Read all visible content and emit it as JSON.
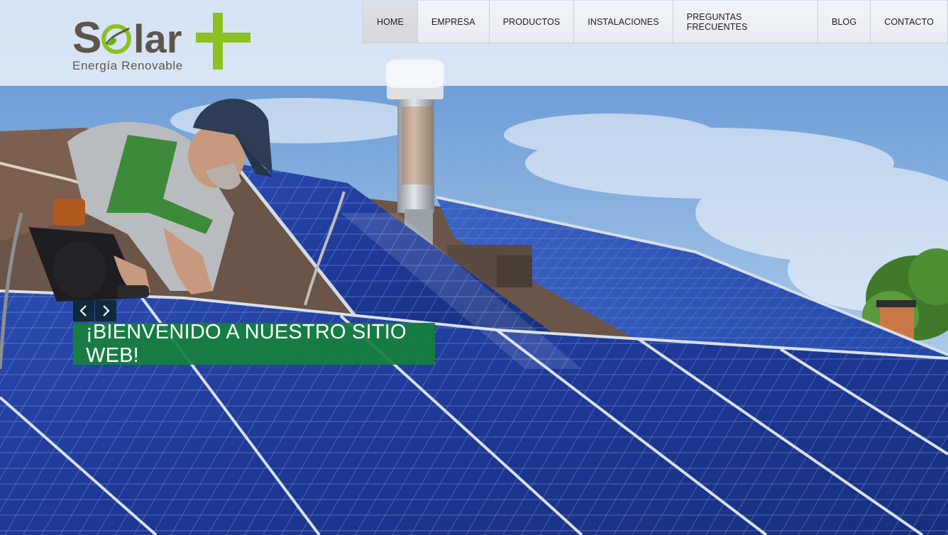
{
  "brand": {
    "logo_text": "Solar",
    "tagline": "Energía Renovable",
    "colors": {
      "logo_dark": "#5e554c",
      "logo_green": "#8cc11f"
    }
  },
  "nav": {
    "items": [
      {
        "label": "HOME",
        "active": true
      },
      {
        "label": "EMPRESA",
        "active": false
      },
      {
        "label": "PRODUCTOS",
        "active": false
      },
      {
        "label": "INSTALACIONES",
        "active": false
      },
      {
        "label": "PREGUNTAS FRECUENTES",
        "active": false
      },
      {
        "label": "BLOG",
        "active": false
      },
      {
        "label": "CONTACTO",
        "active": false
      }
    ]
  },
  "slider": {
    "prev_icon": "chevron-left-icon",
    "next_icon": "chevron-right-icon",
    "caption": "¡BIENVENIDO A NUESTRO SITIO WEB!",
    "caption_bg": "#16803c"
  },
  "colors": {
    "sky": "#8fb4de",
    "panel": "#1f3f9c",
    "frame": "#c8d2dc"
  }
}
